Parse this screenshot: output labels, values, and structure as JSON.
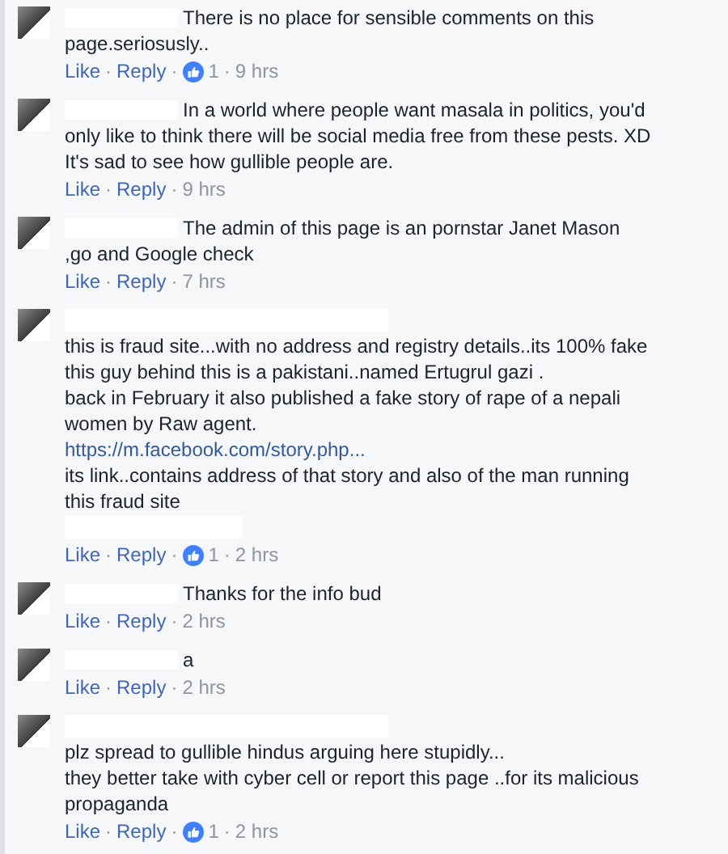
{
  "comments": [
    {
      "kind": "inline",
      "lead": "There is no place for sensible comments on this",
      "body": "page.seriosusly..",
      "mention": false,
      "actions": [
        {
          "kind": "link",
          "text": "Like"
        },
        {
          "kind": "sep",
          "text": "·"
        },
        {
          "kind": "link",
          "text": "Reply"
        },
        {
          "kind": "sep",
          "text": "·"
        },
        {
          "kind": "likes",
          "text": "1"
        },
        {
          "kind": "sep",
          "text": "·"
        },
        {
          "kind": "time",
          "text": "9 hrs"
        }
      ]
    },
    {
      "kind": "inline",
      "lead": "In a world where people want masala in politics, you'd",
      "body": "only like to think there will be social media free from these pests. XD\nIt's sad to see how gullible people are.",
      "mention": false,
      "actions": [
        {
          "kind": "link",
          "text": "Like"
        },
        {
          "kind": "sep",
          "text": "·"
        },
        {
          "kind": "link",
          "text": "Reply"
        },
        {
          "kind": "sep",
          "text": "·"
        },
        {
          "kind": "time",
          "text": "9 hrs"
        }
      ]
    },
    {
      "kind": "inline",
      "lead": "The admin of this page is an pornstar Janet Mason",
      "body": ",go and Google check",
      "mention": false,
      "actions": [
        {
          "kind": "link",
          "text": "Like"
        },
        {
          "kind": "sep",
          "text": "·"
        },
        {
          "kind": "link",
          "text": "Reply"
        },
        {
          "kind": "sep",
          "text": "·"
        },
        {
          "kind": "time",
          "text": "7 hrs"
        }
      ]
    },
    {
      "kind": "stacked",
      "body": "this is fraud site...with no address and registry details..its 100% fake\nthis guy behind this is a pakistani..named Ertugrul gazi .\nback in February it also published a fake story of rape of a nepali\nwomen by Raw agent.",
      "link": "https://m.facebook.com/story.php...",
      "body_after": "its link..contains address of that story and also of the man running\nthis fraud site",
      "mention": true,
      "actions": [
        {
          "kind": "link",
          "text": "Like"
        },
        {
          "kind": "sep",
          "text": "·"
        },
        {
          "kind": "link",
          "text": "Reply"
        },
        {
          "kind": "sep",
          "text": "·"
        },
        {
          "kind": "likes",
          "text": "1"
        },
        {
          "kind": "sep",
          "text": "·"
        },
        {
          "kind": "time",
          "text": "2 hrs"
        }
      ]
    },
    {
      "kind": "inline",
      "lead": "Thanks for the info bud",
      "mention": false,
      "actions": [
        {
          "kind": "link",
          "text": "Like"
        },
        {
          "kind": "sep",
          "text": "·"
        },
        {
          "kind": "link",
          "text": "Reply"
        },
        {
          "kind": "sep",
          "text": "·"
        },
        {
          "kind": "time",
          "text": "2 hrs"
        }
      ]
    },
    {
      "kind": "inline",
      "lead": "a",
      "mention": false,
      "actions": [
        {
          "kind": "link",
          "text": "Like"
        },
        {
          "kind": "sep",
          "text": "·"
        },
        {
          "kind": "link",
          "text": "Reply"
        },
        {
          "kind": "sep",
          "text": "·"
        },
        {
          "kind": "time",
          "text": "2 hrs"
        }
      ]
    },
    {
      "kind": "stacked",
      "body": "plz spread to gullible hindus arguing here stupidly...\nthey better take with cyber cell or report this page ..for its malicious\npropaganda",
      "mention": false,
      "actions": [
        {
          "kind": "link",
          "text": "Like"
        },
        {
          "kind": "sep",
          "text": "·"
        },
        {
          "kind": "link",
          "text": "Reply"
        },
        {
          "kind": "sep",
          "text": "·"
        },
        {
          "kind": "likes",
          "text": "1"
        },
        {
          "kind": "sep",
          "text": "·"
        },
        {
          "kind": "time",
          "text": "2 hrs"
        }
      ]
    }
  ]
}
